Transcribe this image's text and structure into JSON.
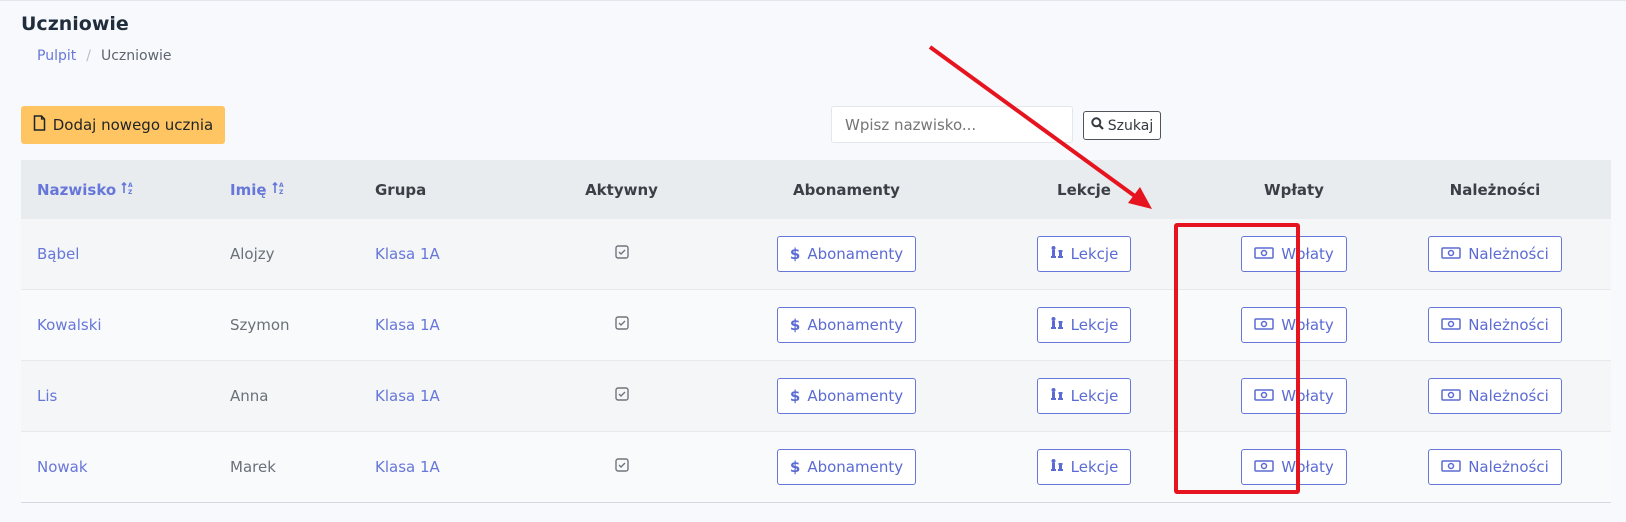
{
  "page": {
    "title": "Uczniowie",
    "breadcrumb": [
      {
        "label": "Pulpit",
        "link": true
      },
      {
        "label": "/",
        "link": false
      },
      {
        "label": "Uczniowie",
        "link": false
      }
    ]
  },
  "toolbar": {
    "add_label": "Dodaj nowego ucznia",
    "search_placeholder": "Wpisz nazwisko...",
    "search_label": "Szukaj"
  },
  "table": {
    "headers": {
      "surname": "Nazwisko",
      "name": "Imię",
      "group": "Grupa",
      "active": "Aktywny",
      "subscriptions": "Abonamenty",
      "lessons": "Lekcje",
      "payments": "Wpłaty",
      "dues": "Należności"
    },
    "rows": [
      {
        "surname": "Bąbel",
        "name": "Alojzy",
        "group": "Klasa 1A"
      },
      {
        "surname": "Kowalski",
        "name": "Szymon",
        "group": "Klasa 1A"
      },
      {
        "surname": "Lis",
        "name": "Anna",
        "group": "Klasa 1A"
      },
      {
        "surname": "Nowak",
        "name": "Marek",
        "group": "Klasa 1A"
      }
    ],
    "actions": {
      "subscriptions": "Abonamenty",
      "lessons": "Lekcje",
      "payments": "Wpłaty",
      "dues": "Należności"
    }
  },
  "colors": {
    "accent": "#6777d9",
    "add_button": "#ffc563",
    "highlight": "#e5141f"
  }
}
